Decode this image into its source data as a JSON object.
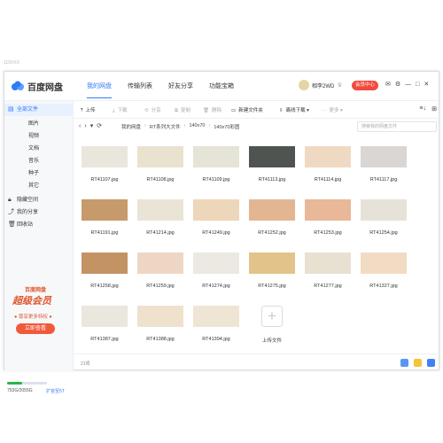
{
  "ghost_text": "115XXX",
  "app": {
    "brand": "百度网盘",
    "nav": [
      "我的网盘",
      "传输列表",
      "好友分享",
      "功能宝箱"
    ],
    "active_nav": 0,
    "user_name": "相李2WD",
    "vip_button": "会员中心",
    "titlebar_icons": [
      "mail-icon",
      "settings-icon",
      "minimize-icon",
      "maximize-icon",
      "close-icon"
    ]
  },
  "sidebar": {
    "items": [
      {
        "label": "全部文件",
        "level": "top",
        "icon": "file-icon",
        "active": true
      },
      {
        "label": "图片",
        "level": "sub"
      },
      {
        "label": "视频",
        "level": "sub"
      },
      {
        "label": "文档",
        "level": "sub"
      },
      {
        "label": "音乐",
        "level": "sub"
      },
      {
        "label": "种子",
        "level": "sub"
      },
      {
        "label": "其它",
        "level": "sub"
      },
      {
        "label": "隐藏空间",
        "level": "top",
        "icon": "lock-icon"
      },
      {
        "label": "我的分享",
        "level": "top",
        "icon": "share-icon"
      },
      {
        "label": "回收站",
        "level": "top",
        "icon": "trash-icon"
      }
    ],
    "promo": {
      "line1": "百度网盘",
      "line2": "超级会员",
      "line3": "● 尊享更多特权 ●",
      "button": "立即查看"
    },
    "storage": "753G/2055G",
    "storage_fraction": 0.37,
    "expand": "扩容至5T"
  },
  "toolbar": {
    "upload": "上传",
    "download": "下载",
    "share": "分享",
    "copy": "复制",
    "delete": "删除",
    "new_folder": "新建文件夹",
    "offline": "离线下载",
    "more": "更多"
  },
  "path": {
    "crumbs": [
      "我的网盘",
      "RT系列大文件",
      "140x70",
      "140x70彩图"
    ],
    "search_placeholder": "搜索我的网盘文件"
  },
  "files": [
    {
      "name": "RT41107.jpg",
      "color": "#e9e6dc"
    },
    {
      "name": "RT41108.jpg",
      "color": "#e8e2cf"
    },
    {
      "name": "RT41109.jpg",
      "color": "#e6e4d6"
    },
    {
      "name": "RT41113.jpg",
      "color": "#505450"
    },
    {
      "name": "RT41114.jpg",
      "color": "#f0d9c3"
    },
    {
      "name": "RT41117.jpg",
      "color": "#d9d6d3"
    },
    {
      "name": "RT41191.jpg",
      "color": "#c69a6a"
    },
    {
      "name": "RT41214.jpg",
      "color": "#e9e4d5"
    },
    {
      "name": "RT41249.jpg",
      "color": "#edd6b9"
    },
    {
      "name": "RT41252.jpg",
      "color": "#e3b693"
    },
    {
      "name": "RT41253.jpg",
      "color": "#e9b898"
    },
    {
      "name": "RT41254.jpg",
      "color": "#e6e2d9"
    },
    {
      "name": "RT41258.jpg",
      "color": "#c49363"
    },
    {
      "name": "RT41259.jpg",
      "color": "#edd7c4"
    },
    {
      "name": "RT41274.jpg",
      "color": "#ece9e2"
    },
    {
      "name": "RT41275.jpg",
      "color": "#e2c389"
    },
    {
      "name": "RT41277.jpg",
      "color": "#e8e1d2"
    },
    {
      "name": "RT41327.jpg",
      "color": "#f1dcc3"
    },
    {
      "name": "RT41387.jpg",
      "color": "#ebe6de"
    },
    {
      "name": "RT41388.jpg",
      "color": "#efe1cc"
    },
    {
      "name": "RT41394.jpg",
      "color": "#efe5d5"
    }
  ],
  "upload_tile": "上传文件",
  "status": {
    "count": "21项"
  },
  "colors": {
    "accent": "#2f7af6",
    "vip": "#f24a3d"
  }
}
